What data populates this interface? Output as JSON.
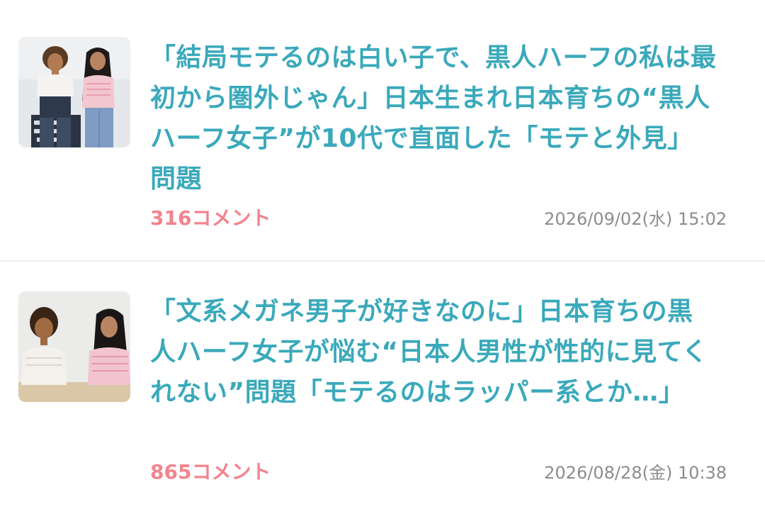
{
  "colors": {
    "title": "#3aa9bb",
    "comments": "#f2848e",
    "timestamp": "#8c8c8c",
    "divider": "#ececec"
  },
  "articles": [
    {
      "title": "「結局モテるのは白い子で、黒人ハーフの私は最初から圏外じゃん」日本生まれ日本育ちの“黒人ハーフ女子”が10代で直面した「モテと外見」問題",
      "comments": "316コメント",
      "timestamp": "2026/09/02(水) 15:02",
      "thumbnail_icon": "article-photo-two-women-standing"
    },
    {
      "title": "「文系メガネ男子が好きなのに」日本育ちの黒人ハーフ女子が悩む“日本人男性が性的に見てくれない”問題「モテるのはラッパー系とか…」",
      "comments": "865コメント",
      "timestamp": "2026/08/28(金) 10:38",
      "thumbnail_icon": "article-photo-two-women-seated"
    }
  ]
}
